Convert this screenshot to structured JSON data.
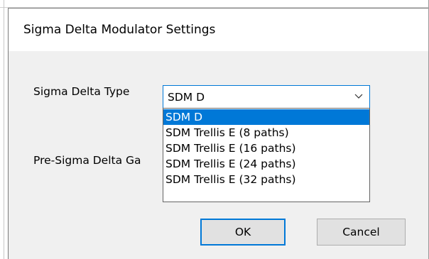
{
  "dialog": {
    "title": "Sigma Delta Modulator Settings"
  },
  "fields": {
    "type_label": "Sigma Delta Type",
    "gain_label": "Pre-Sigma Delta Ga"
  },
  "combo": {
    "selected_value": "SDM D",
    "arrow_icon": "chevron-down-icon",
    "options": [
      "SDM D",
      "SDM Trellis E (8 paths)",
      "SDM Trellis E (16 paths)",
      "SDM Trellis E (24 paths)",
      "SDM Trellis E (32 paths)"
    ],
    "highlighted_index": 0
  },
  "buttons": {
    "ok_label": "OK",
    "cancel_label": "Cancel"
  },
  "colors": {
    "accent": "#0078d7",
    "dialog_bg": "#f0f0f0",
    "button_bg": "#e1e1e1"
  }
}
